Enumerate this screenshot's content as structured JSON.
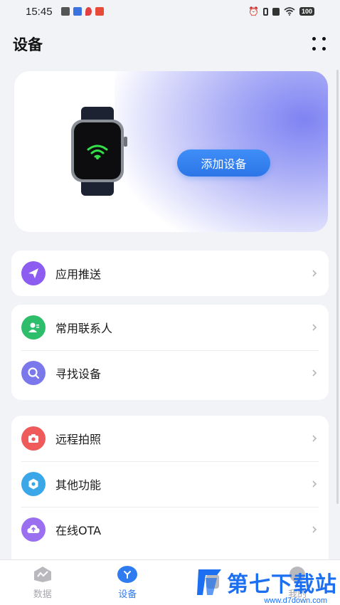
{
  "status_bar": {
    "time": "15:45",
    "battery": "100"
  },
  "header": {
    "title": "设备"
  },
  "device_card": {
    "add_button_label": "添加设备"
  },
  "groups": [
    {
      "items": [
        {
          "label": "应用推送",
          "icon": "paper-plane-icon",
          "color": "#8d5cf0"
        }
      ]
    },
    {
      "items": [
        {
          "label": "常用联系人",
          "icon": "contact-icon",
          "color": "#2ebd6b"
        },
        {
          "label": "寻找设备",
          "icon": "find-icon",
          "color": "#7b78ec"
        }
      ]
    },
    {
      "items": [
        {
          "label": "远程拍照",
          "icon": "camera-icon",
          "color": "#ef5a5a"
        },
        {
          "label": "其他功能",
          "icon": "settings-icon",
          "color": "#3aa7e8"
        },
        {
          "label": "在线OTA",
          "icon": "cloud-upload-icon",
          "color": "#9a6ff0"
        }
      ]
    }
  ],
  "tabbar": {
    "tabs": [
      {
        "label": "数据",
        "active": false
      },
      {
        "label": "设备",
        "active": true
      },
      {
        "label": "",
        "active": false
      },
      {
        "label": "我的",
        "active": false
      }
    ]
  },
  "watermark": {
    "text": "第七下载站",
    "url": "www.d7down.com"
  },
  "colors": {
    "accent": "#2f7cf0",
    "background": "#f2f3f7"
  }
}
